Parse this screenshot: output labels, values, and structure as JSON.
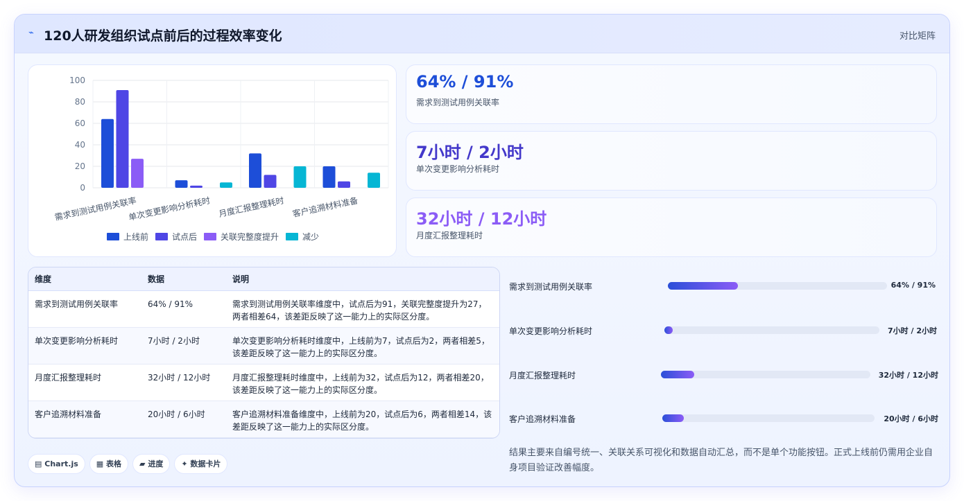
{
  "header": {
    "icon": "pulse-icon",
    "title": "120人研发组织试点前后的过程效率变化",
    "tag": "对比矩阵"
  },
  "chart_data": {
    "type": "bar",
    "categories": [
      "需求到测试用例关联率",
      "单次变更影响分析耗时",
      "月度汇报整理耗时",
      "客户追溯材料准备"
    ],
    "series": [
      {
        "name": "上线前",
        "color": "#1d4ed8",
        "values": [
          64,
          7,
          32,
          20
        ]
      },
      {
        "name": "试点后",
        "color": "#4f46e5",
        "values": [
          91,
          2,
          12,
          6
        ]
      },
      {
        "name": "关联完整度提升",
        "color": "#8b5cf6",
        "values": [
          27,
          null,
          null,
          null
        ]
      },
      {
        "name": "减少",
        "color": "#06b6d4",
        "values": [
          null,
          5,
          20,
          14
        ]
      }
    ],
    "yticks": [
      "0",
      "20",
      "40",
      "60",
      "80",
      "100"
    ],
    "ylim": [
      0,
      100
    ],
    "grid": true,
    "legend": "bottom"
  },
  "kpis": [
    {
      "value": "64% / 91%",
      "label": "需求到测试用例关联率",
      "color": "#1d4ed8"
    },
    {
      "value": "7小时 / 2小时",
      "label": "单次变更影响分析耗时",
      "color": "#4338ca"
    },
    {
      "value": "32小时 / 12小时",
      "label": "月度汇报整理耗时",
      "color": "#8b5cf6"
    }
  ],
  "table": {
    "headers": [
      "维度",
      "数据",
      "说明"
    ],
    "rows": [
      [
        "需求到测试用例关联率",
        "64% / 91%",
        "需求到测试用例关联率维度中，试点后为91，关联完整度提升为27，两者相差64，该差距反映了这一能力上的实际区分度。"
      ],
      [
        "单次变更影响分析耗时",
        "7小时 / 2小时",
        "单次变更影响分析耗时维度中，上线前为7，试点后为2，两者相差5，该差距反映了这一能力上的实际区分度。"
      ],
      [
        "月度汇报整理耗时",
        "32小时 / 12小时",
        "月度汇报整理耗时维度中，上线前为32，试点后为12，两者相差20，该差距反映了这一能力上的实际区分度。"
      ],
      [
        "客户追溯材料准备",
        "20小时 / 6小时",
        "客户追溯材料准备维度中，上线前为20，试点后为6，两者相差14，该差距反映了这一能力上的实际区分度。"
      ]
    ]
  },
  "progress": [
    {
      "label": "需求到测试用例关联率",
      "value": "64% / 91%",
      "fraction": 0.32
    },
    {
      "label": "单次变更影响分析耗时",
      "value": "7小时 / 2小时",
      "fraction": 0.04
    },
    {
      "label": "月度汇报整理耗时",
      "value": "32小时 / 12小时",
      "fraction": 0.16
    },
    {
      "label": "客户追溯材料准备",
      "value": "20小时 / 6小时",
      "fraction": 0.1
    }
  ],
  "note": "结果主要来自编号统一、关联关系可视化和数据自动汇总，而不是单个功能按钮。正式上线前仍需用企业自身项目验证改善幅度。",
  "chips": [
    {
      "icon": "chart-icon",
      "glyph": "▤",
      "label": "Chart.js"
    },
    {
      "icon": "table-icon",
      "glyph": "▦",
      "label": "表格"
    },
    {
      "icon": "progress-icon",
      "glyph": "▰",
      "label": "进度"
    },
    {
      "icon": "sparkle-icon",
      "glyph": "✦",
      "label": "数据卡片"
    }
  ]
}
